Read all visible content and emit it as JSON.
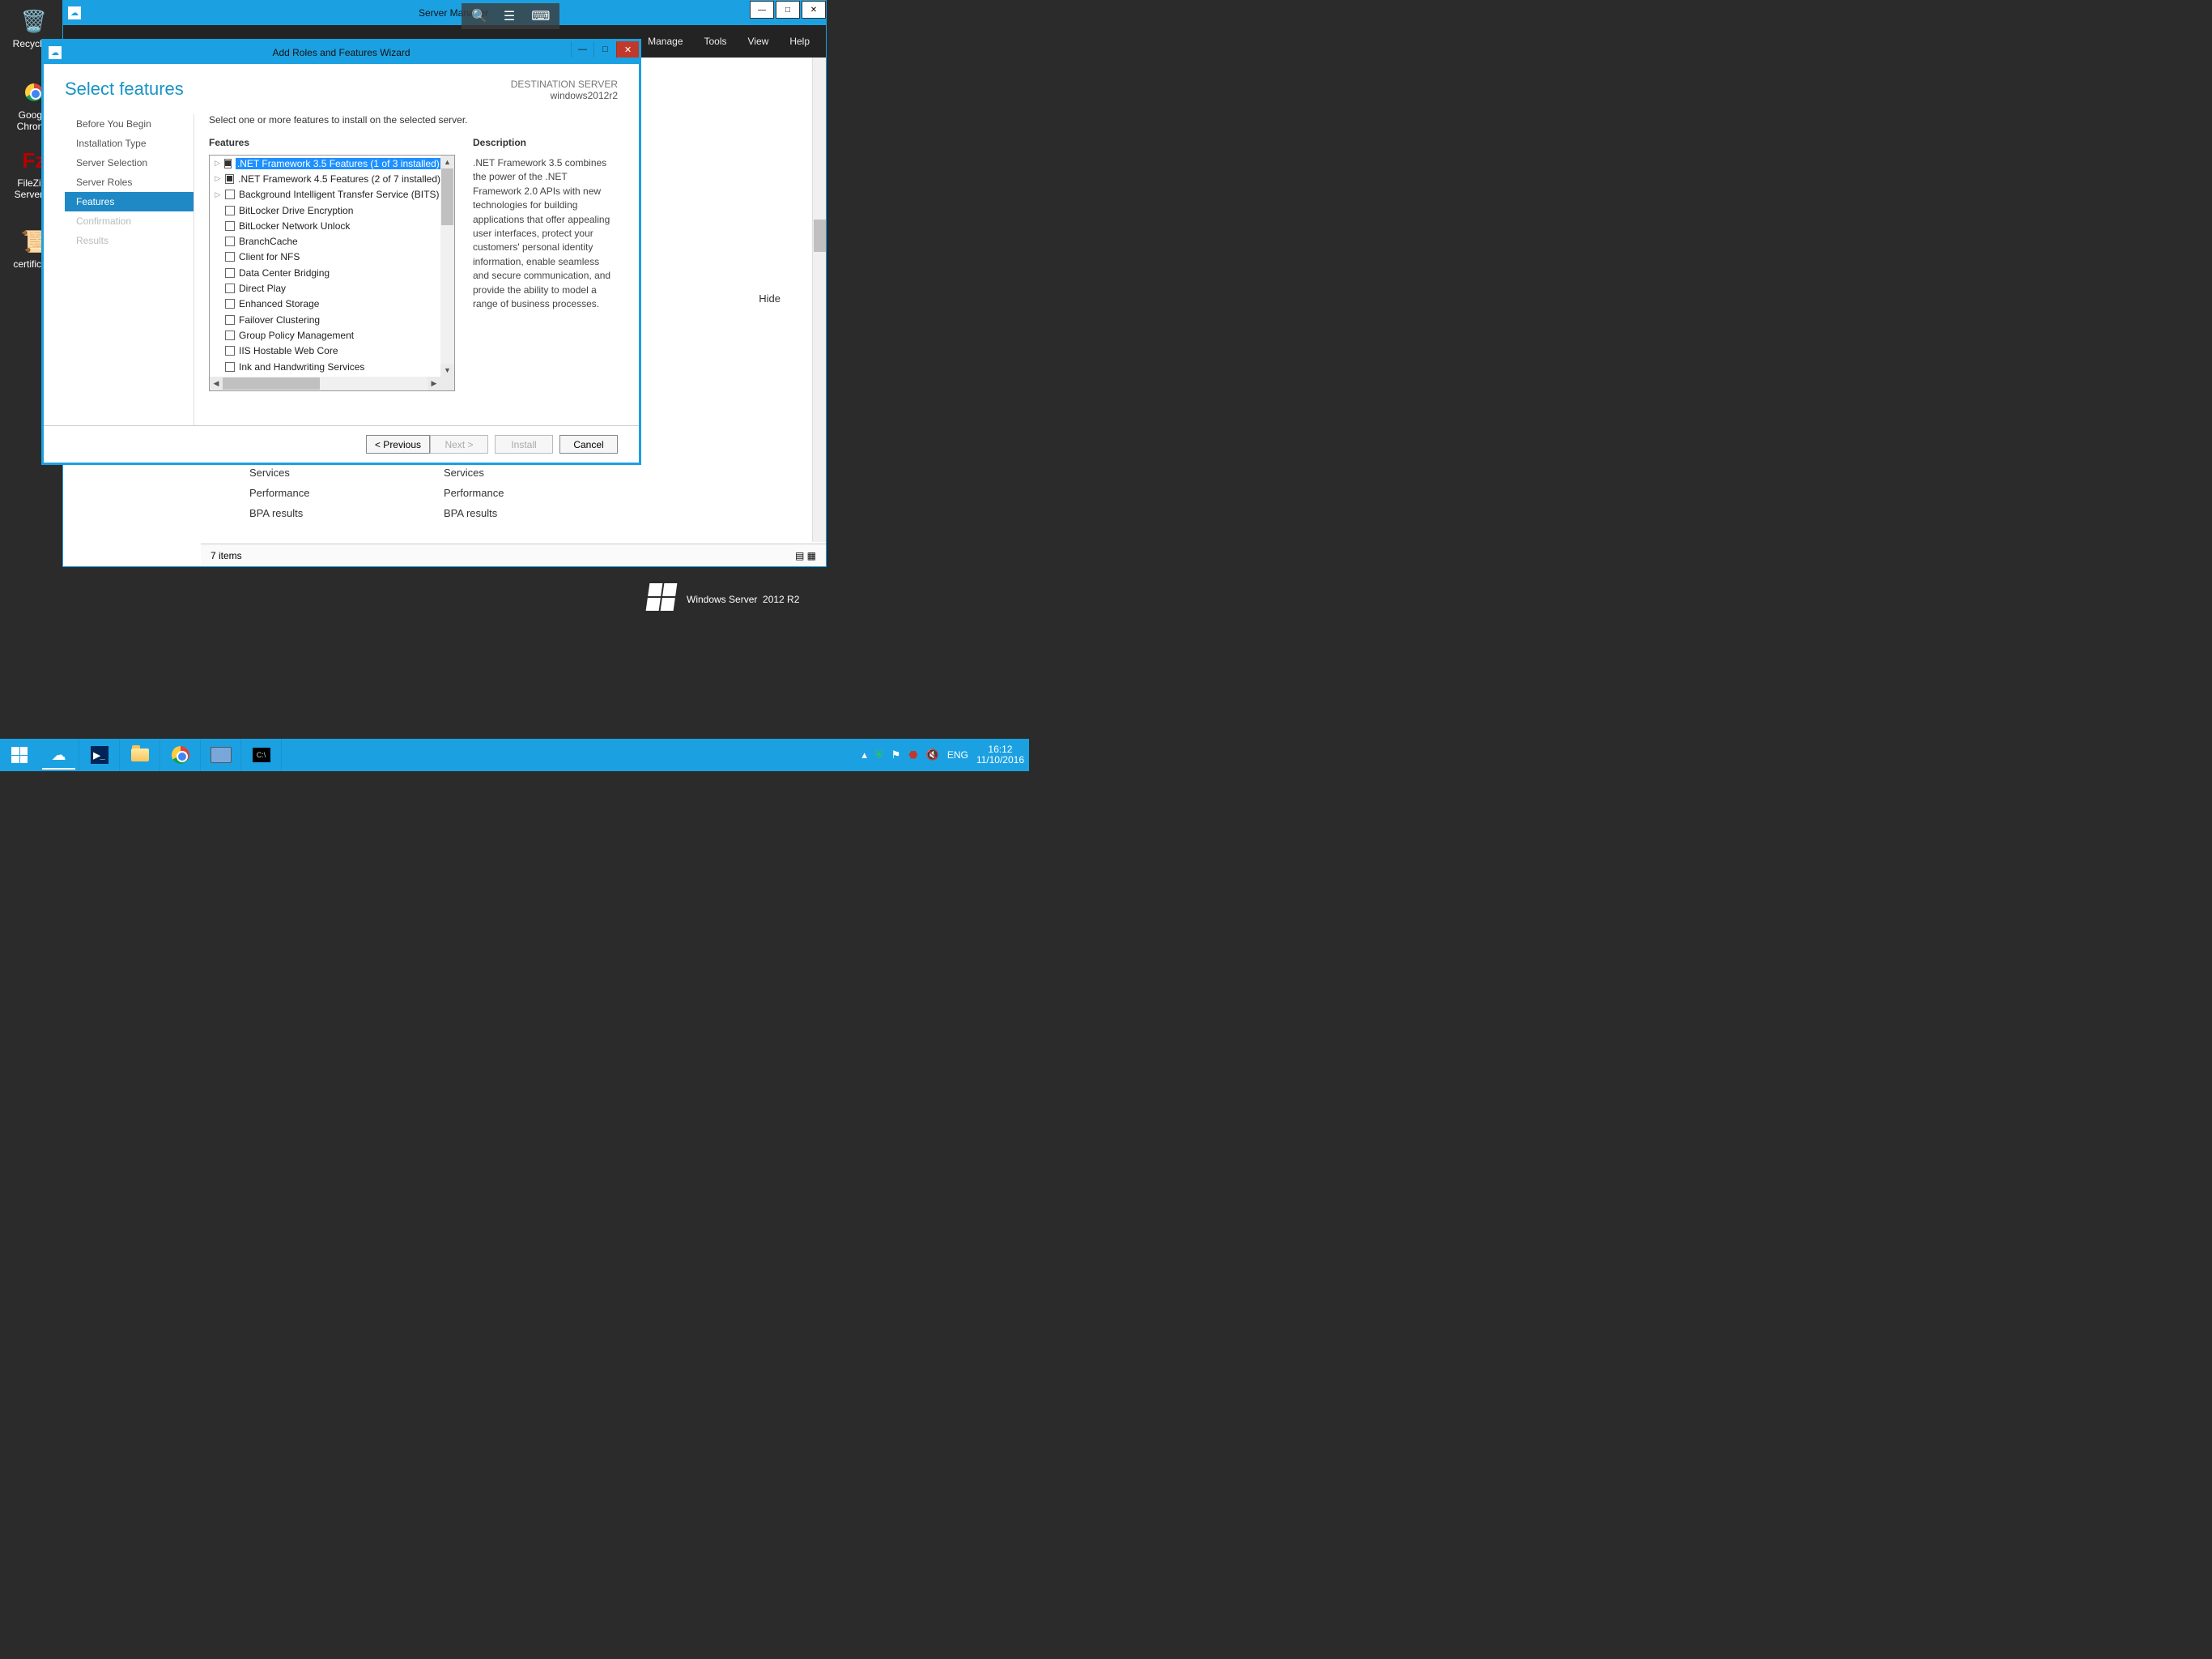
{
  "desktop": {
    "icons": [
      {
        "label": "Recycle..."
      },
      {
        "label": "Google Chrome"
      },
      {
        "label": "FileZilla Server ..."
      },
      {
        "label": "certifica..."
      }
    ]
  },
  "serverManager": {
    "title": "Server Manager",
    "menu": [
      "Manage",
      "Tools",
      "View",
      "Help"
    ],
    "tile": {
      "services": "Services",
      "performance": "Performance",
      "bpa": "BPA results"
    },
    "hide": "Hide",
    "status": "7 items"
  },
  "wizard": {
    "title": "Add Roles and Features Wizard",
    "heading": "Select features",
    "dest_label": "DESTINATION SERVER",
    "dest_server": "windows2012r2",
    "nav": [
      {
        "label": "Before You Begin",
        "state": "normal"
      },
      {
        "label": "Installation Type",
        "state": "normal"
      },
      {
        "label": "Server Selection",
        "state": "normal"
      },
      {
        "label": "Server Roles",
        "state": "normal"
      },
      {
        "label": "Features",
        "state": "active"
      },
      {
        "label": "Confirmation",
        "state": "disabled"
      },
      {
        "label": "Results",
        "state": "disabled"
      }
    ],
    "instruction": "Select one or more features to install on the selected server.",
    "features_label": "Features",
    "features": [
      {
        "label": ".NET Framework 3.5 Features (1 of 3 installed)",
        "expandable": true,
        "check": "partial",
        "selected": true
      },
      {
        "label": ".NET Framework 4.5 Features (2 of 7 installed)",
        "expandable": true,
        "check": "partial"
      },
      {
        "label": "Background Intelligent Transfer Service (BITS)",
        "expandable": true,
        "check": "empty"
      },
      {
        "label": "BitLocker Drive Encryption",
        "expandable": false,
        "check": "empty"
      },
      {
        "label": "BitLocker Network Unlock",
        "expandable": false,
        "check": "empty"
      },
      {
        "label": "BranchCache",
        "expandable": false,
        "check": "empty"
      },
      {
        "label": "Client for NFS",
        "expandable": false,
        "check": "empty"
      },
      {
        "label": "Data Center Bridging",
        "expandable": false,
        "check": "empty"
      },
      {
        "label": "Direct Play",
        "expandable": false,
        "check": "empty"
      },
      {
        "label": "Enhanced Storage",
        "expandable": false,
        "check": "empty"
      },
      {
        "label": "Failover Clustering",
        "expandable": false,
        "check": "empty"
      },
      {
        "label": "Group Policy Management",
        "expandable": false,
        "check": "empty"
      },
      {
        "label": "IIS Hostable Web Core",
        "expandable": false,
        "check": "empty"
      },
      {
        "label": "Ink and Handwriting Services",
        "expandable": false,
        "check": "empty"
      }
    ],
    "desc_label": "Description",
    "desc_text": ".NET Framework 3.5 combines the power of the .NET Framework 2.0 APIs with new technologies for building applications that offer appealing user interfaces, protect your customers' personal identity information, enable seamless and secure communication, and provide the ability to model a range of business processes.",
    "buttons": {
      "previous": "< Previous",
      "next": "Next >",
      "install": "Install",
      "cancel": "Cancel"
    }
  },
  "branding": {
    "text_a": "Windows Server",
    "text_b": "2012 R2"
  },
  "taskbar": {
    "lang": "ENG",
    "time": "16:12",
    "date": "11/10/2016"
  }
}
